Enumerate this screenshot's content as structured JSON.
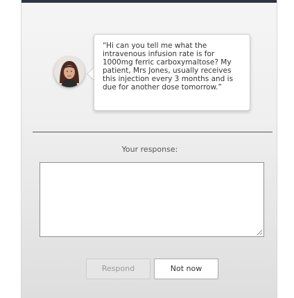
{
  "dialog": {
    "message": "“Hi can you tell me what the intravenous infusion rate is for 1000mg ferric carboxymaltose? My patient, Mrs Jones, usually receives this injection every 3 months and is due for another dose tomorrow.”",
    "avatar_icon": "woman-portrait-icon",
    "response_label": "Your response:",
    "response_value": "",
    "buttons": {
      "respond_label": "Respond",
      "not_now_label": "Not now"
    }
  },
  "colors": {
    "top_strip": "#2f3540",
    "divider": "#555555",
    "disabled_text": "#9a9a9a"
  }
}
